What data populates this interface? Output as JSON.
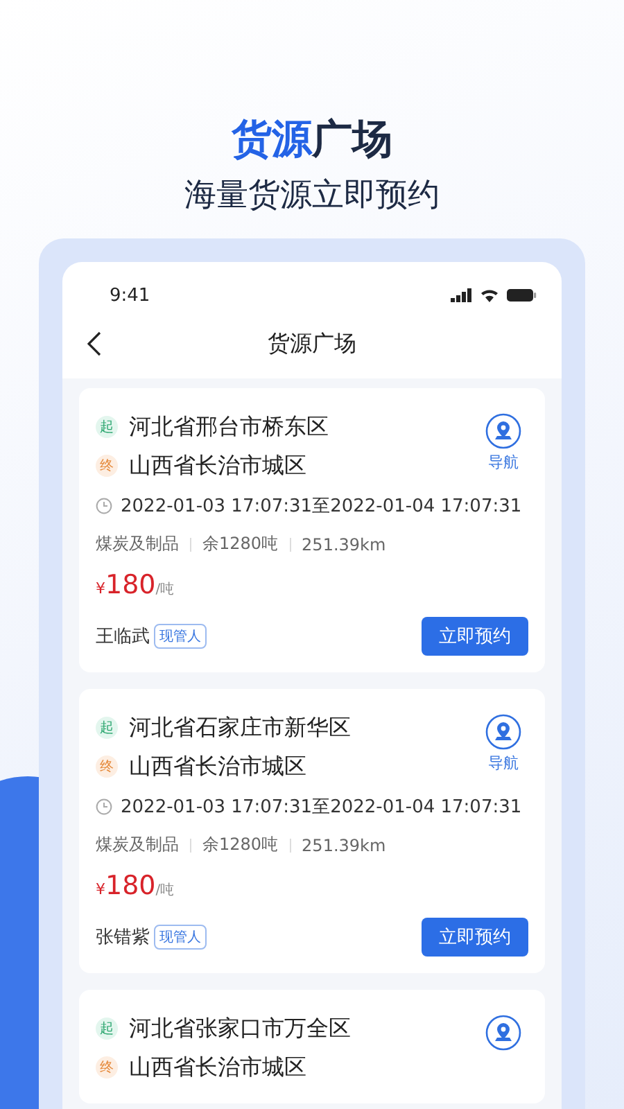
{
  "header": {
    "title_highlight": "货源",
    "title_rest": "广场",
    "subtitle": "海量货源立即预约"
  },
  "status_bar": {
    "time": "9:41"
  },
  "nav": {
    "title": "货源广场"
  },
  "cards": [
    {
      "origin_tag": "起",
      "origin": "河北省邢台市桥东区",
      "dest_tag": "终",
      "dest": "山西省长治市城区",
      "nav_label": "导航",
      "time_range": "2022-01-03 17:07:31至2022-01-04 17:07:31",
      "specs": [
        "煤炭及制品",
        "余1280吨",
        "251.39km"
      ],
      "currency": "¥",
      "price": "180",
      "unit": "/吨",
      "contact": "王临武",
      "role": "现管人",
      "button": "立即预约"
    },
    {
      "origin_tag": "起",
      "origin": "河北省石家庄市新华区",
      "dest_tag": "终",
      "dest": "山西省长治市城区",
      "nav_label": "导航",
      "time_range": "2022-01-03 17:07:31至2022-01-04 17:07:31",
      "specs": [
        "煤炭及制品",
        "余1280吨",
        "251.39km"
      ],
      "currency": "¥",
      "price": "180",
      "unit": "/吨",
      "contact": "张错紫",
      "role": "现管人",
      "button": "立即预约"
    },
    {
      "origin_tag": "起",
      "origin": "河北省张家口市万全区",
      "dest_tag": "终",
      "dest": "山西省长治市城区"
    }
  ]
}
